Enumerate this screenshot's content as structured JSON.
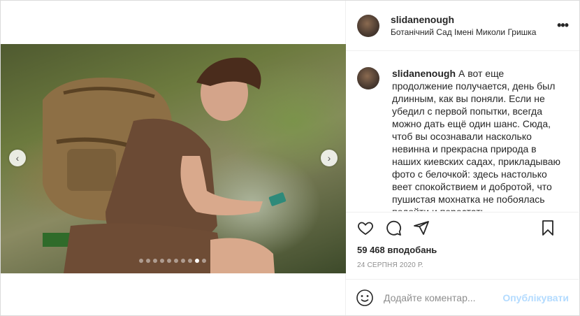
{
  "post": {
    "username": "slidanenough",
    "location": "Ботанічний Сад Імені Миколи Гришка",
    "more_icon": "more-horizontal-icon",
    "caption_username": "slidanenough",
    "caption_text": "А вот еще продолжение получается, день был длинным, как вы поняли. Если не убедил с первой попытки, всегда можно дать ещё один шанс. Сюда, чтоб вы осознавали насколько невинна и прекрасна природа в наших киевских садах, прикладываю фото с белочкой: здесь настолько веет спокойствием и добротой, что пушистая мохнатка не побоялась подойти и перестать",
    "likes": "59 468 вподобань",
    "date": "24 СЕРПНЯ 2020 Р."
  },
  "media": {
    "prev_arrow": "‹",
    "next_arrow": "›",
    "total_slides": 10,
    "active_slide": 9
  },
  "actions": {
    "like_icon": "heart-icon",
    "comment_icon": "comment-icon",
    "share_icon": "paper-plane-icon",
    "save_icon": "bookmark-icon"
  },
  "add_comment": {
    "emoji_icon": "smiley-icon",
    "placeholder": "Додайте коментар...",
    "publish_label": "Опублікувати"
  }
}
